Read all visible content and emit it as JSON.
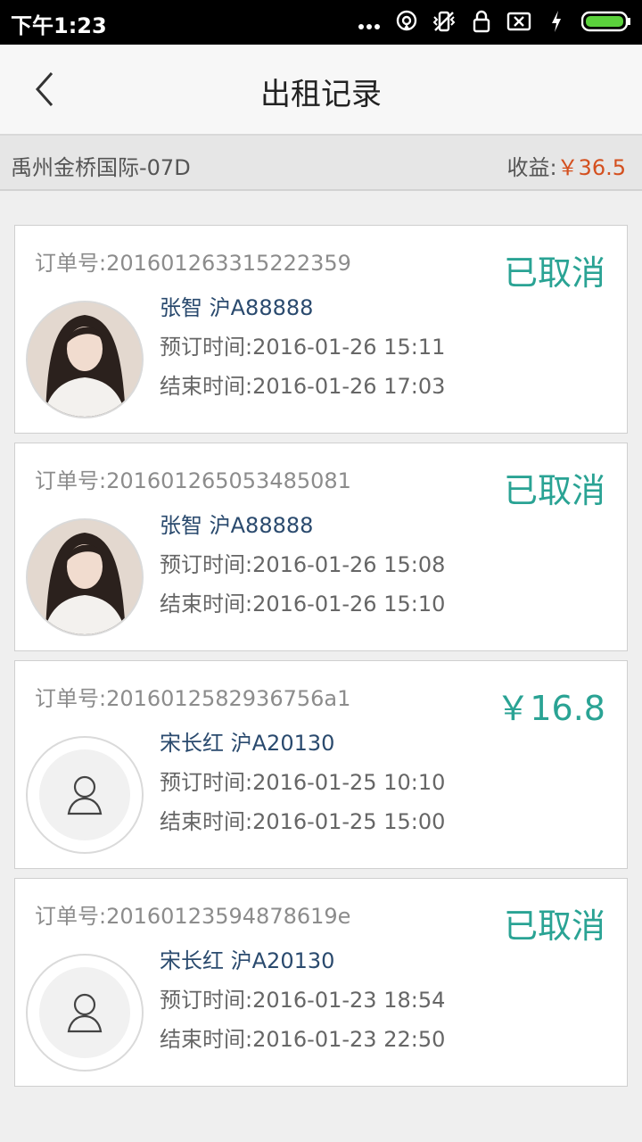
{
  "status_bar": {
    "time": "下午1:23"
  },
  "header": {
    "title": "出租记录"
  },
  "summary": {
    "location": "禹州金桥国际-07D",
    "earnings_label": "收益:",
    "earnings_value": "￥36.5"
  },
  "colors": {
    "accent": "#2aa394",
    "earnings": "#d4501f",
    "name": "#2a4a6e"
  },
  "orders": [
    {
      "order_no": "订单号:201601263315222359",
      "status": "已取消",
      "name_plate": "张智 沪A88888",
      "book_time": "预订时间:2016-01-26 15:11",
      "end_time": "结束时间:2016-01-26 17:03",
      "avatar": "photo"
    },
    {
      "order_no": "订单号:201601265053485081",
      "status": "已取消",
      "name_plate": "张智 沪A88888",
      "book_time": "预订时间:2016-01-26 15:08",
      "end_time": "结束时间:2016-01-26 15:10",
      "avatar": "photo"
    },
    {
      "order_no": "订单号:2016012582936756a1",
      "status": "￥16.8",
      "name_plate": "宋长红 沪A20130",
      "book_time": "预订时间:2016-01-25 10:10",
      "end_time": "结束时间:2016-01-25 15:00",
      "avatar": "default-user-icon"
    },
    {
      "order_no": "订单号:20160123594878619e",
      "status": "已取消",
      "name_plate": "宋长红 沪A20130",
      "book_time": "预订时间:2016-01-23 18:54",
      "end_time": "结束时间:2016-01-23 22:50",
      "avatar": "default-user-icon"
    }
  ]
}
